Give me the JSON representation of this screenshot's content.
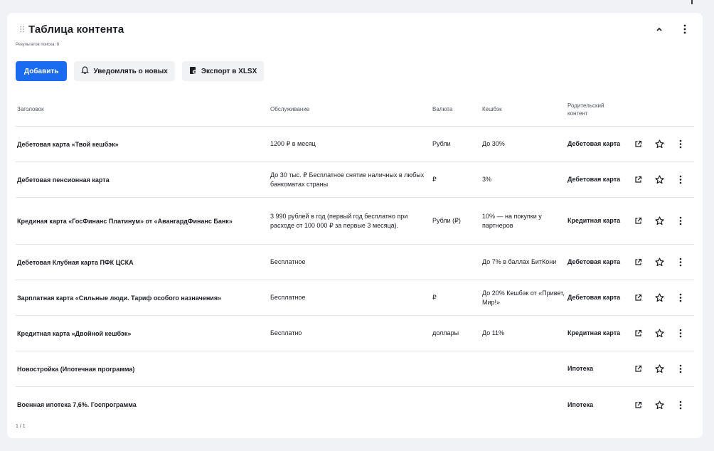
{
  "card": {
    "title": "Таблица контента",
    "results_count": "Результатов поиска: 8",
    "pager": "1 / 1"
  },
  "toolbar": {
    "add_label": "Добавить",
    "notify_label": "Уведомлять о новых",
    "export_label": "Экспорт в XLSX"
  },
  "table": {
    "headers": {
      "title": "Заголовок",
      "service": "Обслуживание",
      "currency": "Валюта",
      "cashback": "Кешбэк",
      "parent": "Родительский контент"
    },
    "rows": [
      {
        "title": "Дебетовая карта «Твой кешбэк»",
        "service": "1200 ₽ в месяц",
        "currency": "Рубли",
        "cashback": "До 30%",
        "parent": "Дебетовая карта"
      },
      {
        "title": "Дебетовая пенсионная карта",
        "service": "До 30 тыс. ₽ Бесплатное снятие наличных в любых банкоматах страны",
        "currency": "₽",
        "cashback": "3%",
        "parent": "Дебетовая карта"
      },
      {
        "title": "Крединая карта «ГосФинанс Платинум» от «АвангардФинанс Банк»",
        "service": "3 990 рублей в год (первый год бесплатно при расходе от 100 000 ₽ за первые 3 месяца).",
        "currency": "Рубли (₽)",
        "cashback": "10% — на покупки у партнеров",
        "parent": "Кредитная карта"
      },
      {
        "title": "Дебетовая Клубная карта ПФК ЦСКА",
        "service": "Бесплатное",
        "currency": "",
        "cashback": "До 7% в баллах БитКони",
        "parent": "Дебетовая карта"
      },
      {
        "title": "Зарплатная карта «Сильные люди. Тариф особого назначения»",
        "service": "Бесплатное",
        "currency": "₽",
        "cashback": "До 20% Кешбэк от «Привет, Мир!»",
        "parent": "Дебетовая карта"
      },
      {
        "title": "Кредитная карта «Двойной кешбэк»",
        "service": "Бесплатно",
        "currency": "доллары",
        "cashback": "До 11%",
        "parent": "Кредитная карта"
      },
      {
        "title": "Новостройка (Ипотечная программа)",
        "service": "",
        "currency": "",
        "cashback": "",
        "parent": "Ипотека"
      },
      {
        "title": "Военная ипотека 7,6%. Госпрограмма",
        "service": "",
        "currency": "",
        "cashback": "",
        "parent": "Ипотека"
      }
    ]
  },
  "icons": {
    "drag": "drag-handle-icon",
    "collapse": "chevron-up-icon",
    "menu": "more-vertical-icon",
    "bell": "bell-icon",
    "export": "file-export-icon",
    "open": "external-link-icon",
    "favorite": "star-icon"
  },
  "colors": {
    "accent": "#1a6bf0",
    "background": "#f1f2f5",
    "card": "#ffffff",
    "divider": "#e3e5ea"
  }
}
